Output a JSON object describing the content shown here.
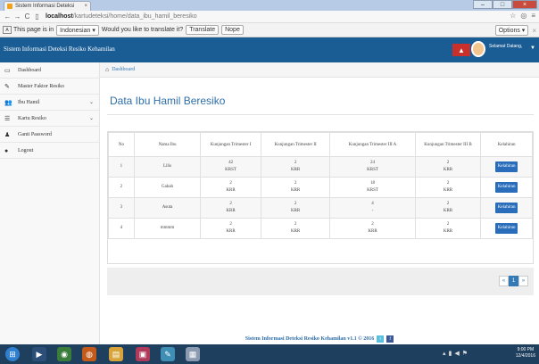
{
  "browser": {
    "tab_title": "Sistem Informasi Deteksi",
    "tab_close": "×",
    "window_min": "–",
    "window_max": "□",
    "window_close": "×",
    "url_host": "localhost",
    "url_path": "/kartudeteksi/home/data_ibu_hamil_beresiko",
    "translate_prompt": "This page is in",
    "translate_language": "Indonesian",
    "translate_question": "Would you like to translate it?",
    "translate_button": "Translate",
    "nope_button": "Nope",
    "options_button": "Options",
    "close_bar": "×"
  },
  "app": {
    "brand": "Sistem Informasi Deteksi Resiko Kehamilan",
    "user_greeting": "Selamat Datang,"
  },
  "sidebar": {
    "items": [
      {
        "label": "Dashboard",
        "icon": "monitor-icon"
      },
      {
        "label": "Master Faktor Resiko",
        "icon": "edit-icon"
      },
      {
        "label": "Ibu Hamil",
        "icon": "users-icon"
      },
      {
        "label": "Kartu Resiko",
        "icon": "list-icon"
      },
      {
        "label": "Ganti Password",
        "icon": "user-icon"
      },
      {
        "label": "Logout",
        "icon": "power-icon"
      }
    ]
  },
  "breadcrumb": {
    "label": "Dashboard"
  },
  "page": {
    "title": "Data Ibu Hamil Beresiko"
  },
  "table": {
    "headers": [
      "No",
      "Nama Ibu",
      "Kunjungan Trimester I",
      "Kunjungan Trimester II",
      "Kunjungan Trimester III A",
      "Kunjungan Trimester III B",
      "Kelahiran"
    ],
    "rows": [
      {
        "no": "1",
        "nama": "Lilis",
        "t1a": "42",
        "t1b": "KRST",
        "t2a": "2",
        "t2b": "KRR",
        "t3aa": "24",
        "t3ab": "KRST",
        "t3ba": "2",
        "t3bb": "KRR",
        "btn": "Kelahiran"
      },
      {
        "no": "2",
        "nama": "Gahah",
        "t1a": "2",
        "t1b": "KRR",
        "t2a": "2",
        "t2b": "KRR",
        "t3aa": "18",
        "t3ab": "KRST",
        "t3ba": "2",
        "t3bb": "KRR",
        "btn": "Kelahiran"
      },
      {
        "no": "3",
        "nama": "Asuta",
        "t1a": "2",
        "t1b": "KRR",
        "t2a": "2",
        "t2b": "KRR",
        "t3aa": "4",
        "t3ab": "-",
        "t3ba": "2",
        "t3bb": "KRR",
        "btn": "Kelahiran"
      },
      {
        "no": "4",
        "nama": "mmmm",
        "t1a": "2",
        "t1b": "KRR",
        "t2a": "2",
        "t2b": "KRR",
        "t3aa": "2",
        "t3ab": "KRR",
        "t3ba": "2",
        "t3bb": "KRR",
        "btn": "Kelahiran"
      }
    ]
  },
  "pagination": {
    "prev": "«",
    "current": "1",
    "next": "»"
  },
  "footer": {
    "text": "Sistem Informasi Deteksi Resiko Kehamilan v1.1 © 2016"
  },
  "taskbar": {
    "time": "9:00 PM",
    "date": "12/4/2016"
  }
}
